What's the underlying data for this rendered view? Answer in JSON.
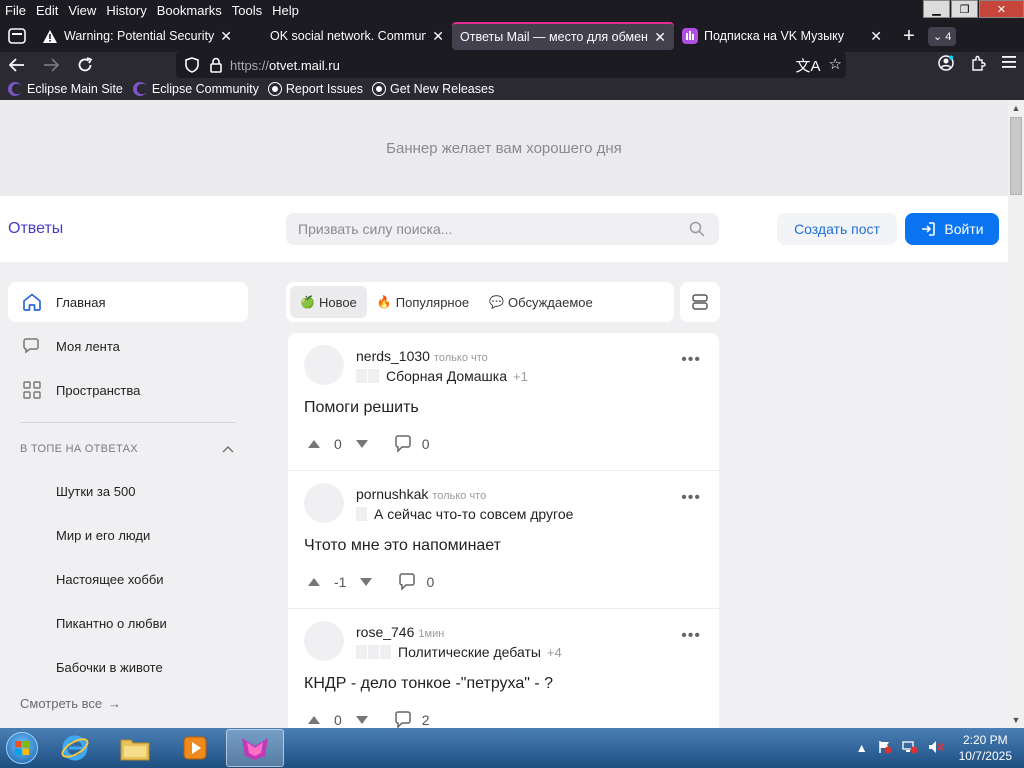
{
  "browser": {
    "menu": [
      "File",
      "Edit",
      "View",
      "History",
      "Bookmarks",
      "Tools",
      "Help"
    ],
    "tabs": [
      {
        "title": "Warning: Potential Security Risk",
        "icon": "warning-icon",
        "active": false
      },
      {
        "title": "OK social network. Communicate",
        "icon": "",
        "active": false
      },
      {
        "title": "Ответы Mail — место для обмена",
        "icon": "",
        "active": true
      },
      {
        "title": "Подписка на VK Музыку",
        "icon": "vk-music-icon",
        "active": false
      }
    ],
    "tab_count": "4",
    "url_prefix": "https://",
    "url_host": "otvet.mail.ru",
    "bookmarks": [
      {
        "label": "Eclipse Main Site",
        "icon": "eclipse-icon"
      },
      {
        "label": "Eclipse Community",
        "icon": "eclipse-icon"
      },
      {
        "label": "Report Issues",
        "icon": "github-icon"
      },
      {
        "label": "Get New Releases",
        "icon": "github-icon"
      }
    ]
  },
  "page": {
    "banner_text": "Баннер желает вам хорошего дня",
    "logo": "Ответы",
    "search_placeholder": "Призвать силу поиска...",
    "create_post": "Создать пост",
    "login": "Войти",
    "sidebar": {
      "nav": [
        {
          "label": "Главная",
          "icon": "home-icon",
          "active": true
        },
        {
          "label": "Моя лента",
          "icon": "feed-icon",
          "active": false
        },
        {
          "label": "Пространства",
          "icon": "grid-icon",
          "active": false
        }
      ],
      "section_title": "В ТОПЕ НА ОТВЕТАХ",
      "topics": [
        "Шутки за 500",
        "Мир и его люди",
        "Настоящее хобби",
        "Пикантно о любви",
        "Бабочки в животе"
      ],
      "more": "Смотреть все"
    },
    "feed_tabs": [
      {
        "label": "Новое",
        "emoji": "🍏",
        "active": true
      },
      {
        "label": "Популярное",
        "emoji": "🔥",
        "active": false
      },
      {
        "label": "Обсуждаемое",
        "emoji": "💬",
        "active": false
      }
    ],
    "posts": [
      {
        "author": "nerds_1030",
        "time": "только что",
        "topic": "Сборная Домашка",
        "topic_plus": "+1",
        "chips": 2,
        "title": "Помоги решить",
        "score": "0",
        "comments": "0"
      },
      {
        "author": "pornushkak",
        "time": "только что",
        "topic": "А сейчас что-то совсем другое",
        "topic_plus": "",
        "chips": 1,
        "title": "Чтото мне это напоминает",
        "score": "-1",
        "comments": "0"
      },
      {
        "author": "rose_746",
        "time": "1мин",
        "topic": "Политические дебаты",
        "topic_plus": "+4",
        "chips": 3,
        "title": "КНДР - дело тонкое -\"петруха\" - ?",
        "score": "0",
        "comments": "2"
      }
    ]
  },
  "taskbar": {
    "time": "2:20 PM",
    "date": "10/7/2025"
  }
}
